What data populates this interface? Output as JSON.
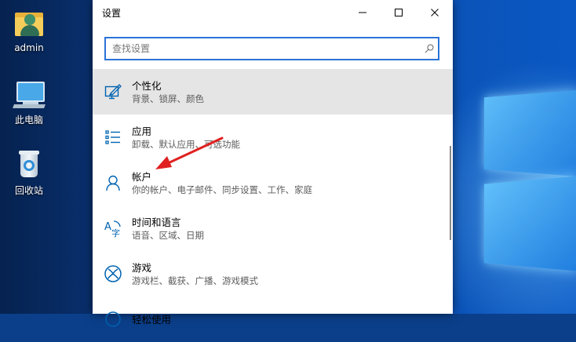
{
  "desktop": {
    "icons": [
      {
        "label": "admin",
        "icon": "user-folder-icon"
      },
      {
        "label": "此电脑",
        "icon": "computer-icon"
      },
      {
        "label": "回收站",
        "icon": "recycle-bin-icon"
      }
    ]
  },
  "window": {
    "title": "设置",
    "controls": {
      "minimize": "—",
      "maximize": "☐",
      "close": "✕"
    },
    "search": {
      "placeholder": "查找设置",
      "value": ""
    },
    "items": [
      {
        "name": "个性化",
        "desc": "背景、锁屏、颜色",
        "icon": "personalization-icon",
        "selected": true
      },
      {
        "name": "应用",
        "desc": "卸载、默认应用、可选功能",
        "icon": "apps-icon",
        "selected": false
      },
      {
        "name": "帐户",
        "desc": "你的帐户、电子邮件、同步设置、工作、家庭",
        "icon": "accounts-icon",
        "selected": false
      },
      {
        "name": "时间和语言",
        "desc": "语音、区域、日期",
        "icon": "time-language-icon",
        "selected": false
      },
      {
        "name": "游戏",
        "desc": "游戏栏、截获、广播、游戏模式",
        "icon": "gaming-icon",
        "selected": false
      },
      {
        "name": "轻松使用",
        "desc": "",
        "icon": "ease-of-access-icon",
        "selected": false
      }
    ]
  },
  "colors": {
    "accent": "#0063b1",
    "selection": "#e5e5e5",
    "annotation_arrow": "#e02020"
  }
}
